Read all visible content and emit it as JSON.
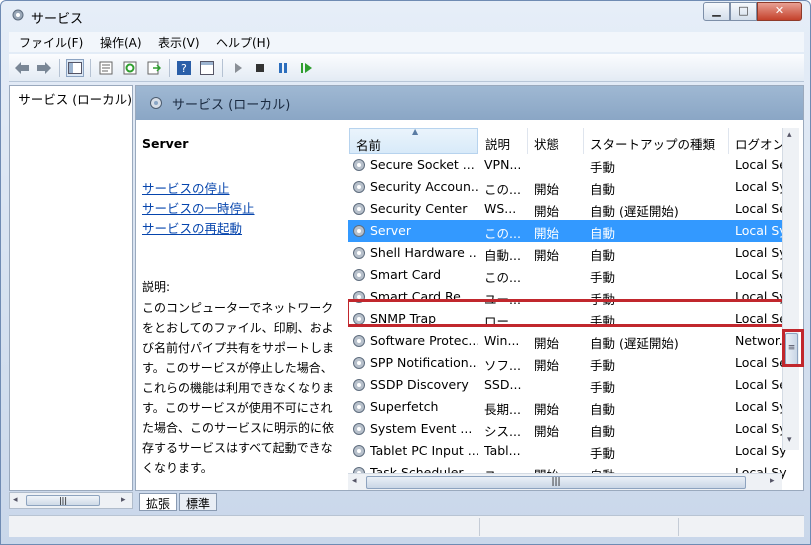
{
  "window": {
    "title": "サービス"
  },
  "menu": [
    "ファイル(F)",
    "操作(A)",
    "表示(V)",
    "ヘルプ(H)"
  ],
  "toolbar": {
    "icons": [
      "back-arrow-icon",
      "forward-arrow-icon",
      "console-tree-icon",
      "properties-icon",
      "refresh-icon",
      "export-list-icon",
      "help-icon",
      "action-pane-icon",
      "start-icon",
      "stop-icon",
      "pause-icon",
      "restart-icon"
    ]
  },
  "tree": {
    "root": "サービス (ローカル)"
  },
  "header": {
    "title": "サービス (ローカル)"
  },
  "detail": {
    "service_name": "Server",
    "actions": [
      "サービスの停止",
      "サービスの一時停止",
      "サービスの再起動"
    ],
    "description_label": "説明:",
    "description_lines": [
      "このコンピューターでネットワーク",
      "をとおしてのファイル、印刷、およ",
      "び名前付パイプ共有をサポートしま",
      "す。このサービスが停止した場合、",
      "これらの機能は利用できなくなりま",
      "す。このサービスが使用不可にされ",
      "た場合、このサービスに明示的に依",
      "存するサービスはすべて起動できな",
      "くなります。"
    ]
  },
  "columns": [
    "名前",
    "説明",
    "状態",
    "スタートアップの種類",
    "ログオン"
  ],
  "rows": [
    {
      "name": "Secure Socket ...",
      "desc": "VPN...",
      "status": "",
      "startup": "手動",
      "logon": "Local Se"
    },
    {
      "name": "Security Accoun...",
      "desc": "この...",
      "status": "開始",
      "startup": "自動",
      "logon": "Local Sy"
    },
    {
      "name": "Security Center",
      "desc": "WS...",
      "status": "開始",
      "startup": "自動 (遅延開始)",
      "logon": "Local Se"
    },
    {
      "name": "Server",
      "desc": "この...",
      "status": "開始",
      "startup": "自動",
      "logon": "Local Sy"
    },
    {
      "name": "Shell Hardware ...",
      "desc": "自動...",
      "status": "開始",
      "startup": "自動",
      "logon": "Local Sy"
    },
    {
      "name": "Smart Card",
      "desc": "この...",
      "status": "",
      "startup": "手動",
      "logon": "Local Se"
    },
    {
      "name": "Smart Card Re...",
      "desc": "ユー...",
      "status": "",
      "startup": "手動",
      "logon": "Local Sy"
    },
    {
      "name": "SNMP Trap",
      "desc": "ロー...",
      "status": "",
      "startup": "手動",
      "logon": "Local Se"
    },
    {
      "name": "Software Protec...",
      "desc": "Win...",
      "status": "開始",
      "startup": "自動 (遅延開始)",
      "logon": "Networ..."
    },
    {
      "name": "SPP Notification...",
      "desc": "ソフ...",
      "status": "開始",
      "startup": "手動",
      "logon": "Local Se"
    },
    {
      "name": "SSDP Discovery",
      "desc": "SSD...",
      "status": "",
      "startup": "手動",
      "logon": "Local Se"
    },
    {
      "name": "Superfetch",
      "desc": "長期...",
      "status": "開始",
      "startup": "自動",
      "logon": "Local Sy"
    },
    {
      "name": "System Event ...",
      "desc": "シス...",
      "status": "開始",
      "startup": "自動",
      "logon": "Local Sy"
    },
    {
      "name": "Tablet PC Input ...",
      "desc": "Tabl...",
      "status": "",
      "startup": "手動",
      "logon": "Local Sy"
    },
    {
      "name": "Task Scheduler",
      "desc": "ユー...",
      "status": "開始",
      "startup": "自動",
      "logon": "Local Sy"
    }
  ],
  "selected_row": "Server",
  "tabs": [
    "拡張",
    "標準"
  ],
  "colors": {
    "selection": "#3399ff",
    "highlight_box": "#c1272d",
    "header": "#8aa6c5"
  }
}
